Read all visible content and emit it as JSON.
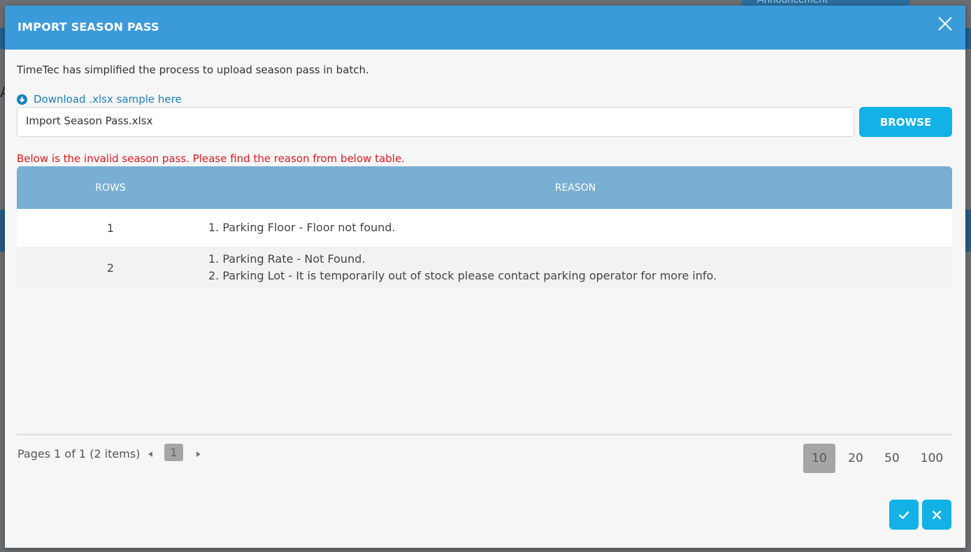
{
  "background": {
    "banner_text": "Announcement",
    "side_letter": "A"
  },
  "modal": {
    "title": "IMPORT SEASON PASS",
    "intro": "TimeTec has simplified the process to upload season pass in batch.",
    "download_link": "Download .xlsx sample here",
    "file_input_value": "Import Season Pass.xlsx",
    "browse_label": "BROWSE",
    "error_message": "Below is the invalid season pass. Please find the reason from below table.",
    "table": {
      "headers": {
        "rows": "ROWS",
        "reason": "REASON"
      },
      "rows": [
        {
          "row": "1",
          "reasons": [
            "1. Parking Floor - Floor not found."
          ]
        },
        {
          "row": "2",
          "reasons": [
            "1. Parking Rate - Not Found.",
            "2. Parking Lot - It is temporarily out of stock please contact parking operator for more info."
          ]
        }
      ]
    },
    "pager": {
      "info": "Pages 1 of 1 (2 items)",
      "current_page": "1",
      "page_sizes": [
        "10",
        "20",
        "50",
        "100"
      ],
      "active_size": "10"
    }
  },
  "colors": {
    "header": "#3b9ad9",
    "accent_button": "#12b1e6",
    "table_header": "#79afd3",
    "error": "#e0181c",
    "link": "#1a7fc1"
  },
  "icons": {
    "close": "close-icon",
    "download": "download-circle-icon",
    "prev": "caret-left-icon",
    "next": "caret-right-icon",
    "confirm": "check-icon",
    "cancel": "x-icon"
  }
}
